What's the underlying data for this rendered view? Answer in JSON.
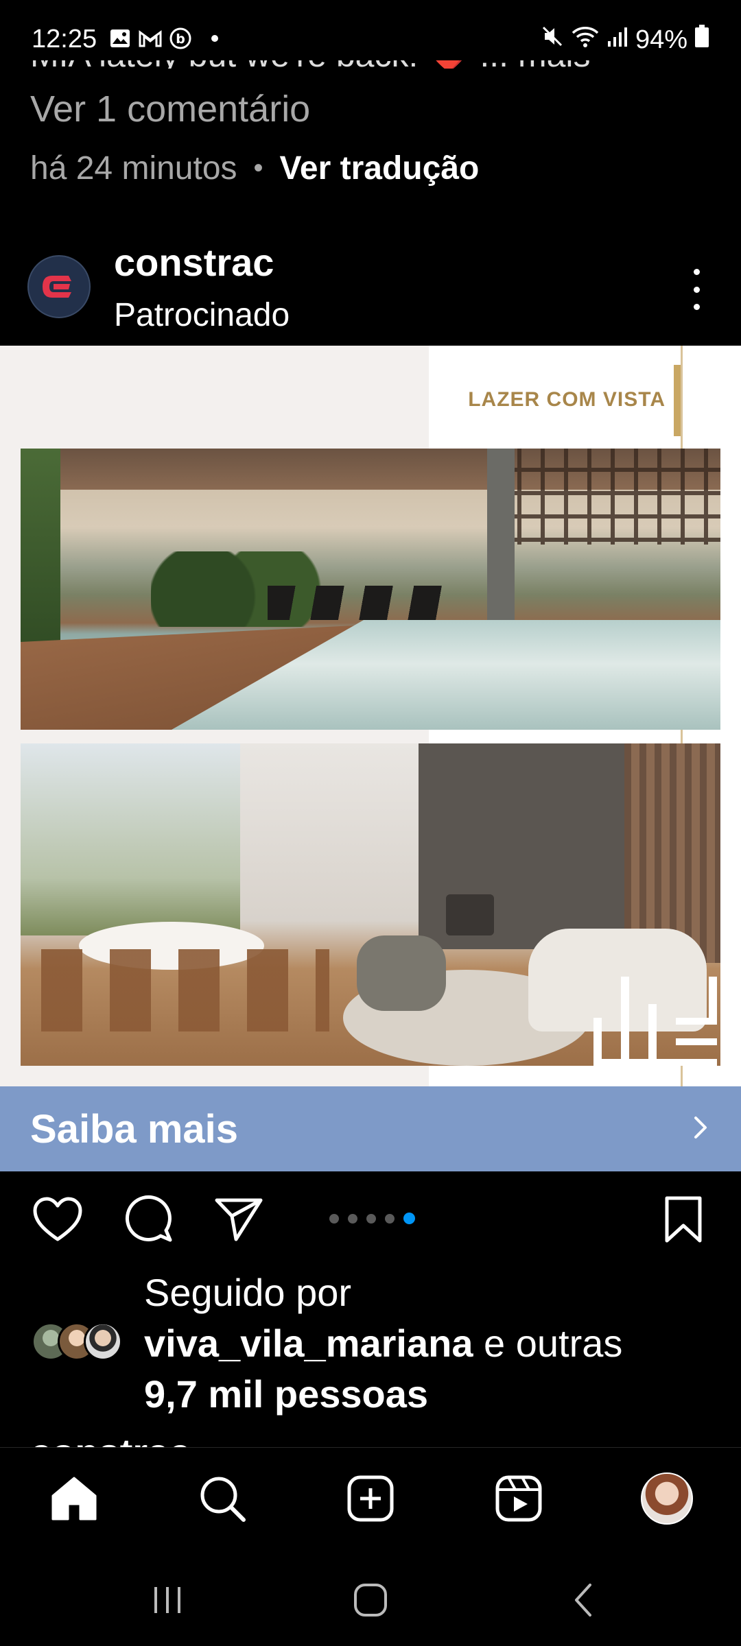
{
  "status_bar": {
    "time": "12:25",
    "left_icons": [
      "gallery-icon",
      "gmail-icon",
      "b-icon"
    ],
    "battery": "94%",
    "right_icons": [
      "mute-icon",
      "wifi-icon",
      "signal-icon",
      "battery-icon"
    ]
  },
  "previous_post": {
    "caption_cut": "MIA lately but we're back! ❤️ ... mais",
    "view_comments": "Ver 1 comentário",
    "time_ago": "há 24 minutos",
    "separator": "•",
    "translate": "Ver tradução"
  },
  "post": {
    "username": "constrac",
    "sponsored": "Patrocinado",
    "ad_tag": "LAZER COM VISTA",
    "cta_label": "Saiba mais",
    "carousel_total": 5,
    "carousel_active": 5
  },
  "followed": {
    "prefix": "Seguido por",
    "user": "viva_vila_mariana",
    "suffix": " e outras",
    "line3": "9,7 mil pessoas"
  },
  "next_post": {
    "username_cut": "constrac"
  },
  "bottom_nav": [
    "home-icon",
    "search-icon",
    "create-icon",
    "reels-icon",
    "profile-avatar"
  ],
  "colors": {
    "background": "#000000",
    "cta_bar": "#7e9ac8",
    "carousel_active": "#0095f6",
    "gold_accent": "#c9a763"
  }
}
